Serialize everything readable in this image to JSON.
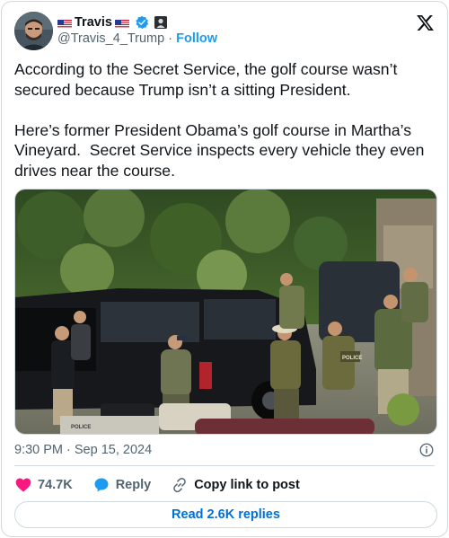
{
  "author": {
    "display_name": "Travis",
    "handle": "@Travis_4_Trump",
    "separator": "·",
    "follow_label": "Follow"
  },
  "icons": {
    "brand": "x-logo-icon",
    "verified": "verified-badge-icon",
    "affiliate": "affiliate-badge-icon",
    "like": "heart-icon",
    "reply": "reply-bubble-icon",
    "copy": "link-icon",
    "info": "info-icon"
  },
  "colors": {
    "accent": "#1d9bf0",
    "like": "#f91880",
    "text": "#0f1419",
    "muted": "#536471",
    "link": "#006fd6"
  },
  "tweet": {
    "text": "According to the Secret Service, the golf course wasn’t secured because Trump isn’t a sitting President.\n\nHere’s former President Obama’s golf course in Martha’s Vineyard.  Secret Service inspects every vehicle they even drives near the course.",
    "timestamp": "9:30 PM · Sep 15, 2024",
    "photo_police_label": "POLICE"
  },
  "actions": {
    "likes": "74.7K",
    "reply_label": "Reply",
    "copy_label": "Copy link to post",
    "read_replies_label": "Read 2.6K replies"
  }
}
